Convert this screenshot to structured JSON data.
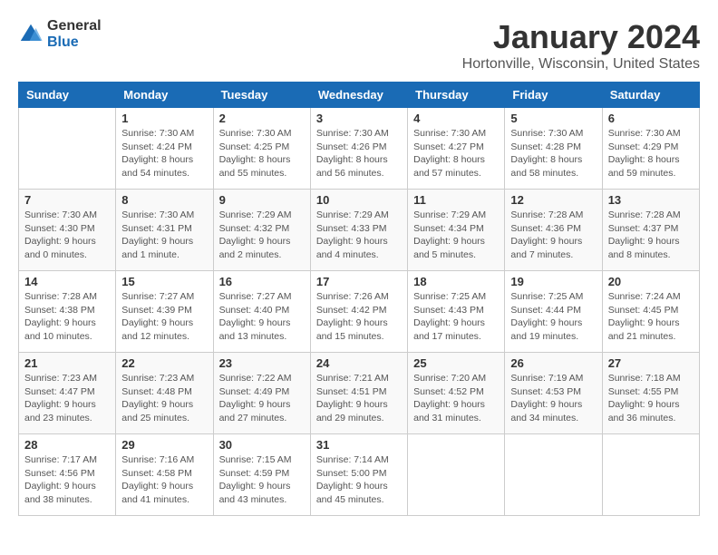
{
  "logo": {
    "line1": "General",
    "line2": "Blue"
  },
  "title": "January 2024",
  "location": "Hortonville, Wisconsin, United States",
  "days_of_week": [
    "Sunday",
    "Monday",
    "Tuesday",
    "Wednesday",
    "Thursday",
    "Friday",
    "Saturday"
  ],
  "weeks": [
    [
      {
        "day": "",
        "info": ""
      },
      {
        "day": "1",
        "info": "Sunrise: 7:30 AM\nSunset: 4:24 PM\nDaylight: 8 hours\nand 54 minutes."
      },
      {
        "day": "2",
        "info": "Sunrise: 7:30 AM\nSunset: 4:25 PM\nDaylight: 8 hours\nand 55 minutes."
      },
      {
        "day": "3",
        "info": "Sunrise: 7:30 AM\nSunset: 4:26 PM\nDaylight: 8 hours\nand 56 minutes."
      },
      {
        "day": "4",
        "info": "Sunrise: 7:30 AM\nSunset: 4:27 PM\nDaylight: 8 hours\nand 57 minutes."
      },
      {
        "day": "5",
        "info": "Sunrise: 7:30 AM\nSunset: 4:28 PM\nDaylight: 8 hours\nand 58 minutes."
      },
      {
        "day": "6",
        "info": "Sunrise: 7:30 AM\nSunset: 4:29 PM\nDaylight: 8 hours\nand 59 minutes."
      }
    ],
    [
      {
        "day": "7",
        "info": "Sunrise: 7:30 AM\nSunset: 4:30 PM\nDaylight: 9 hours\nand 0 minutes."
      },
      {
        "day": "8",
        "info": "Sunrise: 7:30 AM\nSunset: 4:31 PM\nDaylight: 9 hours\nand 1 minute."
      },
      {
        "day": "9",
        "info": "Sunrise: 7:29 AM\nSunset: 4:32 PM\nDaylight: 9 hours\nand 2 minutes."
      },
      {
        "day": "10",
        "info": "Sunrise: 7:29 AM\nSunset: 4:33 PM\nDaylight: 9 hours\nand 4 minutes."
      },
      {
        "day": "11",
        "info": "Sunrise: 7:29 AM\nSunset: 4:34 PM\nDaylight: 9 hours\nand 5 minutes."
      },
      {
        "day": "12",
        "info": "Sunrise: 7:28 AM\nSunset: 4:36 PM\nDaylight: 9 hours\nand 7 minutes."
      },
      {
        "day": "13",
        "info": "Sunrise: 7:28 AM\nSunset: 4:37 PM\nDaylight: 9 hours\nand 8 minutes."
      }
    ],
    [
      {
        "day": "14",
        "info": "Sunrise: 7:28 AM\nSunset: 4:38 PM\nDaylight: 9 hours\nand 10 minutes."
      },
      {
        "day": "15",
        "info": "Sunrise: 7:27 AM\nSunset: 4:39 PM\nDaylight: 9 hours\nand 12 minutes."
      },
      {
        "day": "16",
        "info": "Sunrise: 7:27 AM\nSunset: 4:40 PM\nDaylight: 9 hours\nand 13 minutes."
      },
      {
        "day": "17",
        "info": "Sunrise: 7:26 AM\nSunset: 4:42 PM\nDaylight: 9 hours\nand 15 minutes."
      },
      {
        "day": "18",
        "info": "Sunrise: 7:25 AM\nSunset: 4:43 PM\nDaylight: 9 hours\nand 17 minutes."
      },
      {
        "day": "19",
        "info": "Sunrise: 7:25 AM\nSunset: 4:44 PM\nDaylight: 9 hours\nand 19 minutes."
      },
      {
        "day": "20",
        "info": "Sunrise: 7:24 AM\nSunset: 4:45 PM\nDaylight: 9 hours\nand 21 minutes."
      }
    ],
    [
      {
        "day": "21",
        "info": "Sunrise: 7:23 AM\nSunset: 4:47 PM\nDaylight: 9 hours\nand 23 minutes."
      },
      {
        "day": "22",
        "info": "Sunrise: 7:23 AM\nSunset: 4:48 PM\nDaylight: 9 hours\nand 25 minutes."
      },
      {
        "day": "23",
        "info": "Sunrise: 7:22 AM\nSunset: 4:49 PM\nDaylight: 9 hours\nand 27 minutes."
      },
      {
        "day": "24",
        "info": "Sunrise: 7:21 AM\nSunset: 4:51 PM\nDaylight: 9 hours\nand 29 minutes."
      },
      {
        "day": "25",
        "info": "Sunrise: 7:20 AM\nSunset: 4:52 PM\nDaylight: 9 hours\nand 31 minutes."
      },
      {
        "day": "26",
        "info": "Sunrise: 7:19 AM\nSunset: 4:53 PM\nDaylight: 9 hours\nand 34 minutes."
      },
      {
        "day": "27",
        "info": "Sunrise: 7:18 AM\nSunset: 4:55 PM\nDaylight: 9 hours\nand 36 minutes."
      }
    ],
    [
      {
        "day": "28",
        "info": "Sunrise: 7:17 AM\nSunset: 4:56 PM\nDaylight: 9 hours\nand 38 minutes."
      },
      {
        "day": "29",
        "info": "Sunrise: 7:16 AM\nSunset: 4:58 PM\nDaylight: 9 hours\nand 41 minutes."
      },
      {
        "day": "30",
        "info": "Sunrise: 7:15 AM\nSunset: 4:59 PM\nDaylight: 9 hours\nand 43 minutes."
      },
      {
        "day": "31",
        "info": "Sunrise: 7:14 AM\nSunset: 5:00 PM\nDaylight: 9 hours\nand 45 minutes."
      },
      {
        "day": "",
        "info": ""
      },
      {
        "day": "",
        "info": ""
      },
      {
        "day": "",
        "info": ""
      }
    ]
  ]
}
